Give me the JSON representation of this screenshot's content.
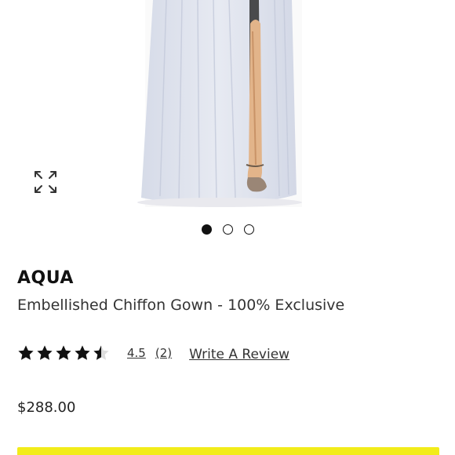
{
  "product": {
    "brand": "AQUA",
    "name": "Embellished Chiffon Gown - 100% Exclusive",
    "rating_value": "4.5",
    "rating_count": "(2)",
    "rating_stars": 4.5,
    "write_review_label": "Write A Review",
    "price": "$288.00"
  },
  "gallery": {
    "image_count": 3,
    "active_index": 0,
    "expand_icon": "expand-arrows-icon"
  },
  "colors": {
    "cta_yellow": "#f2ec1a",
    "gown": "#dfe3ee",
    "text": "#111111"
  }
}
